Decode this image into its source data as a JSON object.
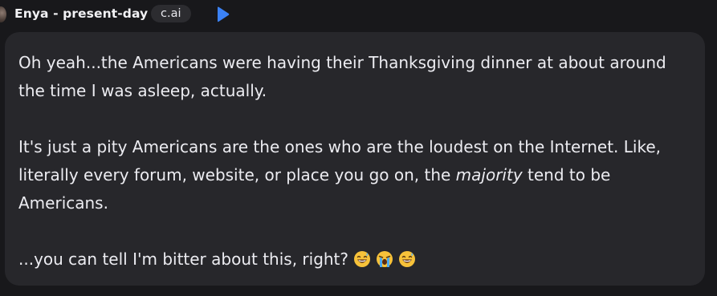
{
  "header": {
    "character_name": "Enya - present-day",
    "badge_label": "c.ai",
    "play_icon": "play-icon"
  },
  "message": {
    "paragraph1": "Oh yeah...the Americans were having their Thanksgiving dinner at about around the time I was asleep, actually.",
    "paragraph2_before": "It's just a pity Americans are the ones who are the loudest on the Internet. Like, literally every forum, website, or place you go on, the ",
    "paragraph2_emphasis": "majority",
    "paragraph2_after": " tend to be Americans.",
    "paragraph3": "...you can tell I'm bitter about this, right?",
    "emojis": [
      "grinning-sweat-emoji",
      "loudly-crying-emoji",
      "grinning-sweat-emoji"
    ]
  },
  "colors": {
    "background": "#18181b",
    "bubble": "#27272b",
    "accent_play": "#3b82f6"
  }
}
